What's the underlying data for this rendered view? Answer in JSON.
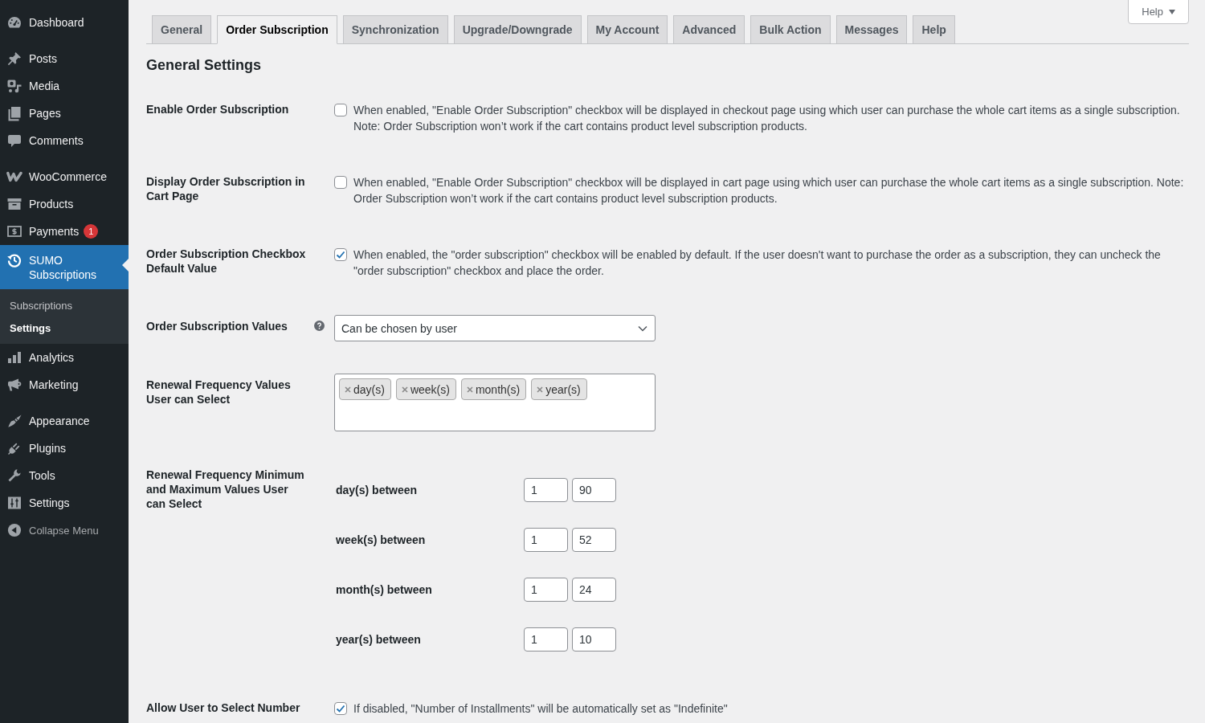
{
  "sidebar": {
    "groups": [
      {
        "items": [
          {
            "label": "Dashboard",
            "selected": false
          }
        ]
      },
      {
        "items": [
          {
            "label": "Posts",
            "selected": false
          },
          {
            "label": "Media",
            "selected": false
          },
          {
            "label": "Pages",
            "selected": false
          },
          {
            "label": "Comments",
            "selected": false
          }
        ]
      },
      {
        "items": [
          {
            "label": "WooCommerce",
            "selected": false
          },
          {
            "label": "Products",
            "selected": false
          },
          {
            "label": "Payments",
            "selected": false,
            "badge": "1"
          },
          {
            "label": "SUMO Subscriptions",
            "selected": true,
            "children": [
              {
                "label": "Subscriptions",
                "selected": false
              },
              {
                "label": "Settings",
                "selected": true
              }
            ]
          },
          {
            "label": "Analytics",
            "selected": false
          },
          {
            "label": "Marketing",
            "selected": false
          }
        ]
      },
      {
        "items": [
          {
            "label": "Appearance",
            "selected": false
          },
          {
            "label": "Plugins",
            "selected": false
          },
          {
            "label": "Tools",
            "selected": false
          },
          {
            "label": "Settings",
            "selected": false
          }
        ]
      }
    ],
    "collapse_label": "Collapse Menu"
  },
  "help_button": {
    "label": "Help"
  },
  "tabs": [
    {
      "label": "General",
      "selected": false
    },
    {
      "label": "Order Subscription",
      "selected": true
    },
    {
      "label": "Synchronization",
      "selected": false
    },
    {
      "label": "Upgrade/Downgrade",
      "selected": false
    },
    {
      "label": "My Account",
      "selected": false
    },
    {
      "label": "Advanced",
      "selected": false
    },
    {
      "label": "Bulk Action",
      "selected": false
    },
    {
      "label": "Messages",
      "selected": false
    },
    {
      "label": "Help",
      "selected": false
    }
  ],
  "section_title": "General Settings",
  "settings": [
    {
      "kind": "checkbox",
      "label": "Enable Order Subscription",
      "checked": false,
      "description": "When enabled, \"Enable Order Subscription\" checkbox will be displayed in checkout page using which user can purchase the whole cart items as a single subscription. Note: Order Subscription won’t work if the cart contains product level subscription products."
    },
    {
      "kind": "checkbox",
      "label": "Display Order Subscription in Cart Page",
      "checked": false,
      "description": "When enabled, \"Enable Order Subscription\" checkbox will be displayed in cart page using which user can purchase the whole cart items as a single subscription. Note: Order Subscription won’t work if the cart contains product level subscription products."
    },
    {
      "kind": "checkbox",
      "label": "Order Subscription Checkbox Default Value",
      "checked": true,
      "description": "When enabled, the \"order subscription\" checkbox will be enabled by default. If the user doesn't want to purchase the order as a subscription, they can uncheck the \"order subscription\" checkbox and place the order."
    },
    {
      "kind": "select",
      "label": "Order Subscription Values",
      "help_tip": true,
      "value": "Can be chosen by user"
    },
    {
      "kind": "multiselect",
      "label": "Renewal Frequency Values User can Select",
      "tags": [
        "day(s)",
        "week(s)",
        "month(s)",
        "year(s)"
      ]
    },
    {
      "kind": "range_table",
      "label": "Renewal Frequency Minimum and Maximum Values User can Select",
      "ranges": [
        {
          "label": "day(s) between",
          "min": "1",
          "max": "90"
        },
        {
          "label": "week(s) between",
          "min": "1",
          "max": "52"
        },
        {
          "label": "month(s) between",
          "min": "1",
          "max": "24"
        },
        {
          "label": "year(s) between",
          "min": "1",
          "max": "10"
        }
      ]
    },
    {
      "kind": "checkbox",
      "label": "Allow User to Select Number",
      "checked": true,
      "description": "If disabled, \"Number of Installments\" will be automatically set as \"Indefinite\""
    }
  ]
}
